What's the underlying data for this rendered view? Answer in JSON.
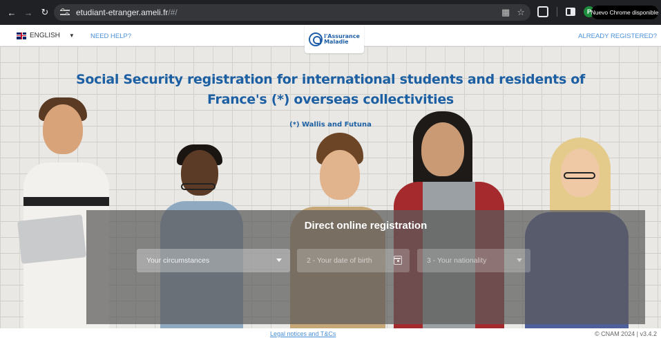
{
  "browser": {
    "url_host": "etudiant-etranger.ameli.fr",
    "url_path": "/#/",
    "update_button": "Nuevo Chrome disponible",
    "profile_initial": "P"
  },
  "header": {
    "language": "ENGLISH",
    "need_help": "NEED HELP?",
    "already_registered": "ALREADY REGISTERED?",
    "logo_line1": "l'Assurance",
    "logo_line2": "Maladie"
  },
  "hero": {
    "title": "Social Security registration for international students and residents of France's (*) overseas collectivities",
    "note": "(*) Wallis and Futuna"
  },
  "registration": {
    "title": "Direct online registration",
    "fields": [
      {
        "label": "Your circumstances",
        "type": "select",
        "enabled": true
      },
      {
        "label": "2 - Your date of birth",
        "type": "date",
        "enabled": false
      },
      {
        "label": "3 - Your nationality",
        "type": "select",
        "enabled": false
      }
    ]
  },
  "footer": {
    "legal": "Legal notices and T&Cs",
    "version": "© CNAM 2024 | v3.4.2"
  },
  "colors": {
    "brand_blue": "#1d5fa3",
    "link_blue": "#4a90d9"
  }
}
